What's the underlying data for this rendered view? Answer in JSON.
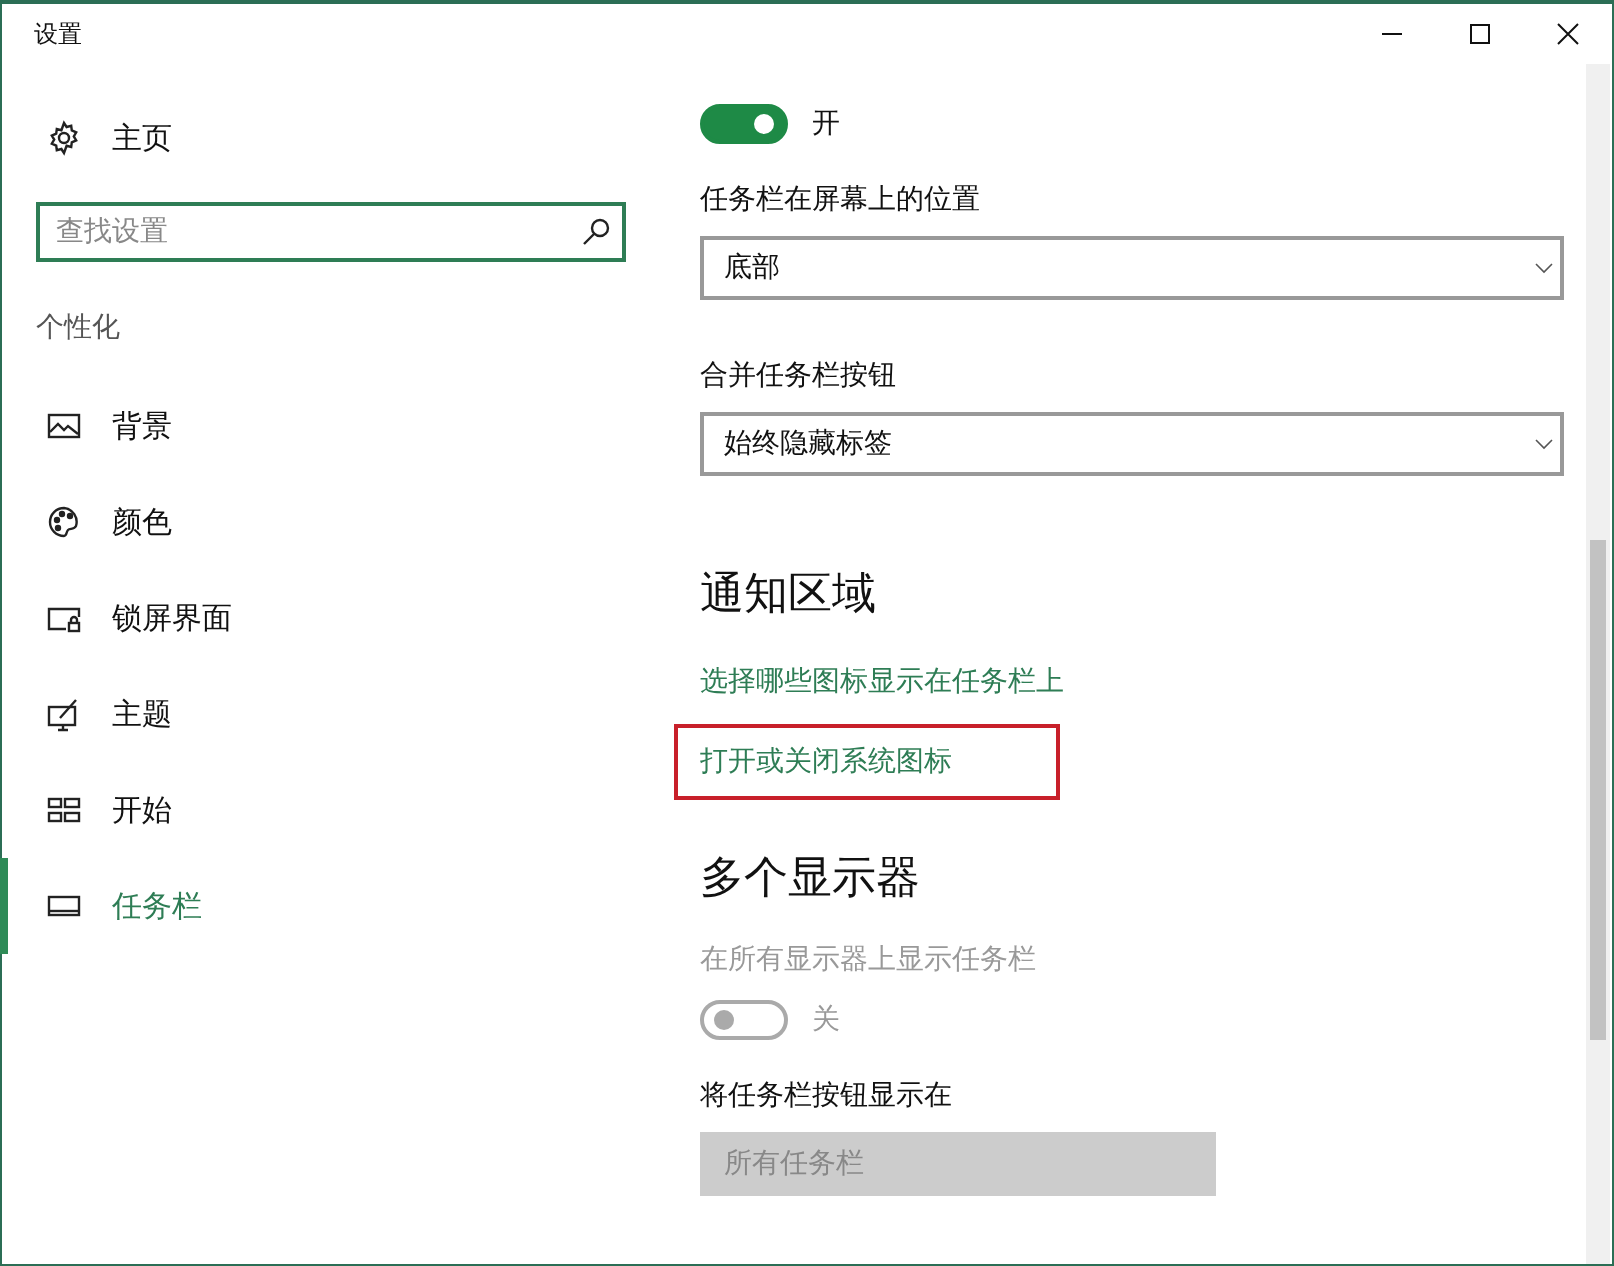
{
  "window": {
    "title": "设置"
  },
  "sidebar": {
    "home": {
      "label": "主页"
    },
    "search": {
      "placeholder": "查找设置"
    },
    "section": "个性化",
    "items": [
      {
        "label": "背景",
        "selected": false
      },
      {
        "label": "颜色",
        "selected": false
      },
      {
        "label": "锁屏界面",
        "selected": false
      },
      {
        "label": "主题",
        "selected": false
      },
      {
        "label": "开始",
        "selected": false
      },
      {
        "label": "任务栏",
        "selected": true
      }
    ]
  },
  "content": [
    {
      "kind": "toggle",
      "on": true,
      "state_label": "开",
      "disabled": false
    },
    {
      "kind": "label",
      "text": "任务栏在屏幕上的位置",
      "disabled": false
    },
    {
      "kind": "dropdown",
      "value": "底部",
      "disabled": false
    },
    {
      "kind": "label",
      "text": "合并任务栏按钮",
      "disabled": false
    },
    {
      "kind": "dropdown",
      "value": "始终隐藏标签",
      "disabled": false
    },
    {
      "kind": "heading",
      "text": "通知区域"
    },
    {
      "kind": "link",
      "text": "选择哪些图标显示在任务栏上",
      "highlighted": false
    },
    {
      "kind": "link",
      "text": "打开或关闭系统图标",
      "highlighted": true
    },
    {
      "kind": "heading",
      "text": "多个显示器"
    },
    {
      "kind": "label",
      "text": "在所有显示器上显示任务栏",
      "disabled": true
    },
    {
      "kind": "toggle",
      "on": false,
      "state_label": "关",
      "disabled": true
    },
    {
      "kind": "label",
      "text": "将任务栏按钮显示在",
      "disabled": false
    },
    {
      "kind": "dropdown",
      "value": "所有任务栏",
      "disabled": true
    }
  ]
}
